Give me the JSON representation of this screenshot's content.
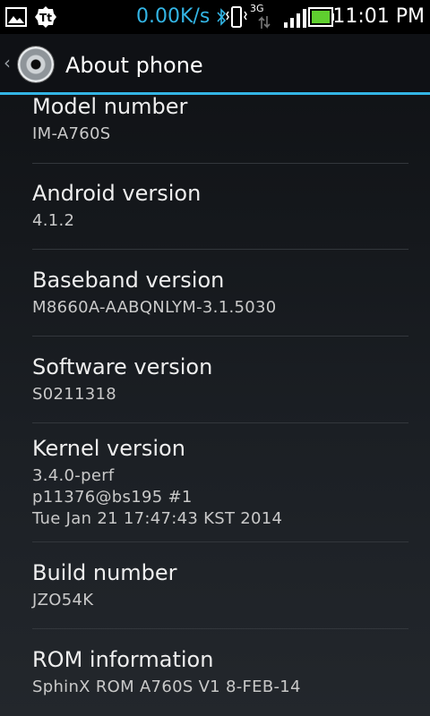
{
  "status_bar": {
    "net_speed": "0.00K/s",
    "network_type": "3G",
    "time": "11:01 PM",
    "icons": [
      "picture-icon",
      "tt-app-icon",
      "bluetooth-icon",
      "vibrate-icon",
      "data-arrows-icon",
      "signal-icon",
      "battery-icon"
    ],
    "accent_color": "#33b5e5"
  },
  "action_bar": {
    "title": "About phone",
    "icon": "settings-disc-icon"
  },
  "items": [
    {
      "label": "Model number",
      "value": "IM-A760S"
    },
    {
      "label": "Android version",
      "value": "4.1.2"
    },
    {
      "label": "Baseband version",
      "value": "M8660A-AABQNLYM-3.1.5030"
    },
    {
      "label": "Software version",
      "value": "S0211318"
    },
    {
      "label": "Kernel version",
      "value_lines": [
        "3.4.0-perf",
        "p11376@bs195 #1",
        "Tue Jan 21 17:47:43 KST 2014"
      ]
    },
    {
      "label": "Build number",
      "value": "JZO54K"
    },
    {
      "label": "ROM information",
      "value": "SphinX ROM A760S V1 8-FEB-14"
    }
  ]
}
